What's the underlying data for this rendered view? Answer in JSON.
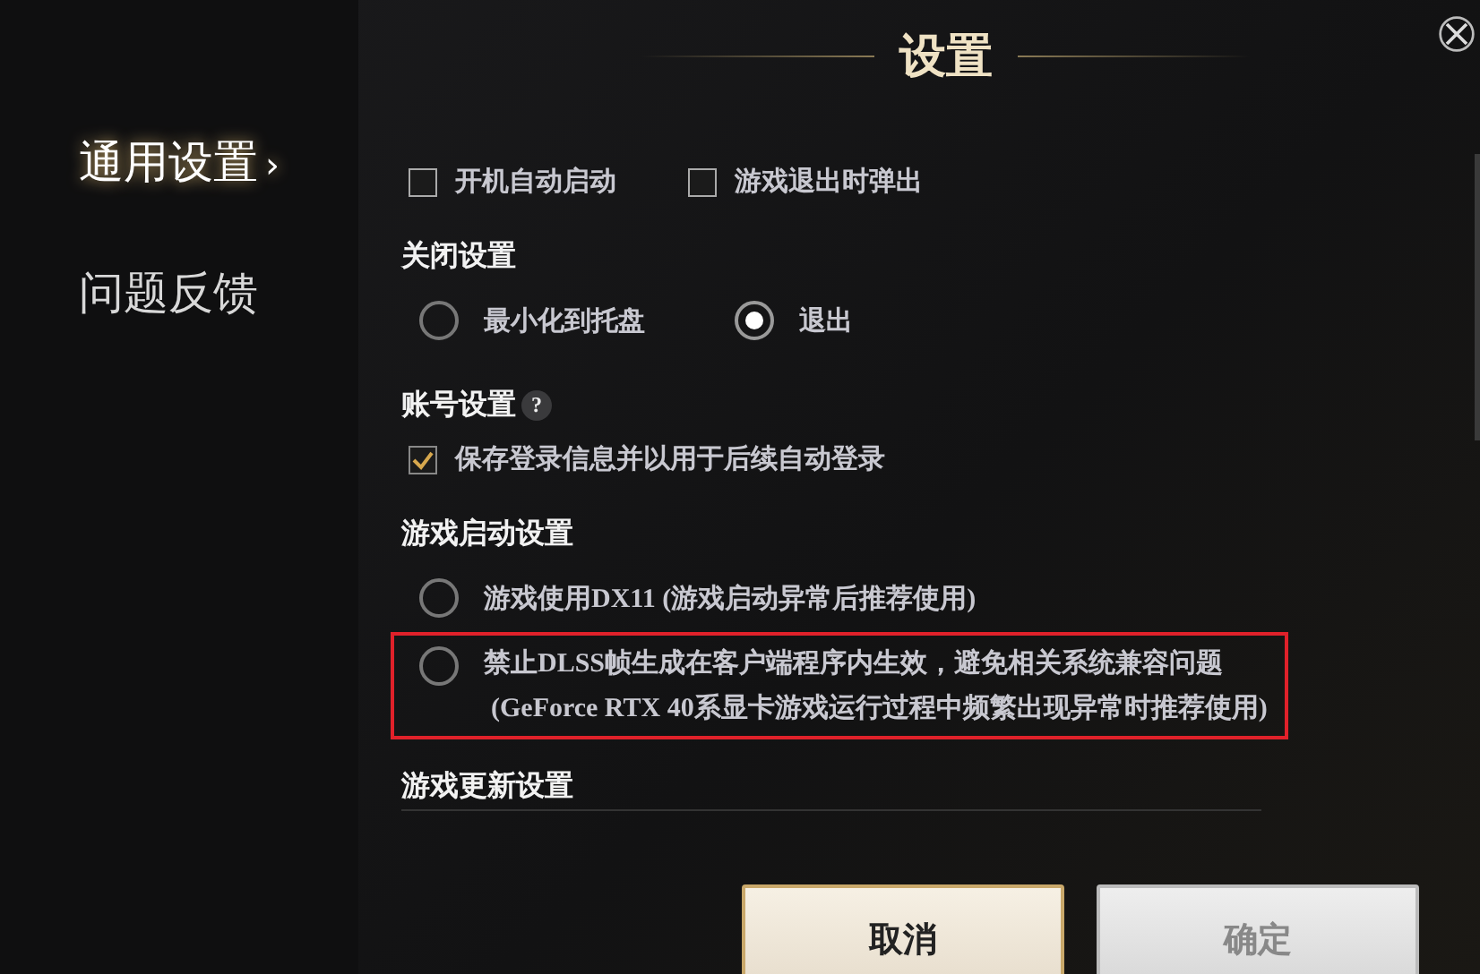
{
  "window": {
    "title": "设置"
  },
  "sidebar": {
    "items": [
      {
        "label": "通用设置",
        "selected": true,
        "arrow": "›"
      },
      {
        "label": "问题反馈",
        "selected": false
      }
    ]
  },
  "sections": [
    {
      "kind": "checks",
      "options": [
        {
          "label": "开机自动启动",
          "checked": false
        },
        {
          "label": "游戏退出时弹出",
          "checked": false
        }
      ]
    },
    {
      "kind": "radios",
      "title": "关闭设置",
      "options": [
        {
          "label": "最小化到托盘",
          "selected": false
        },
        {
          "label": "退出",
          "selected": true
        }
      ]
    },
    {
      "kind": "checks",
      "title": "账号设置",
      "help": "?",
      "options": [
        {
          "label": "保存登录信息并以用于后续自动登录",
          "checked": true
        }
      ]
    },
    {
      "kind": "radiolist",
      "title": "游戏启动设置",
      "options": [
        {
          "label": "游戏使用DX11 (游戏启动异常后推荐使用)",
          "selected": false,
          "highlighted": false
        },
        {
          "label": "禁止DLSS帧生成在客户端程序内生效，避免相关系统兼容问题",
          "note": "(GeForce  RTX  40系显卡游戏运行过程中频繁出现异常时推荐使用)",
          "selected": false,
          "highlighted": true
        }
      ]
    },
    {
      "kind": "heading",
      "title": "游戏更新设置"
    }
  ],
  "buttons": [
    {
      "label": "取消",
      "disabled": false
    },
    {
      "label": "确定",
      "disabled": true
    }
  ]
}
